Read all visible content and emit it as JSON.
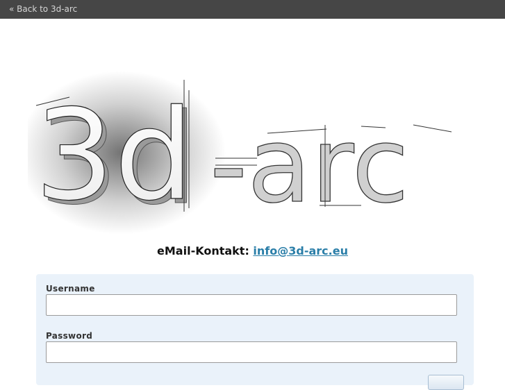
{
  "topbar": {
    "back_link": "« Back to 3d-arc"
  },
  "logo": {
    "text_3d": "3d",
    "text_rest": "-arc"
  },
  "contact": {
    "label": "eMail-Kontakt:",
    "email": "info@3d-arc.eu"
  },
  "login": {
    "username_label": "Username",
    "username_value": "",
    "password_label": "Password",
    "password_value": ""
  },
  "colors": {
    "topbar_bg": "#464646",
    "panel_bg": "#eaf2fa",
    "link": "#2a7ea8"
  }
}
